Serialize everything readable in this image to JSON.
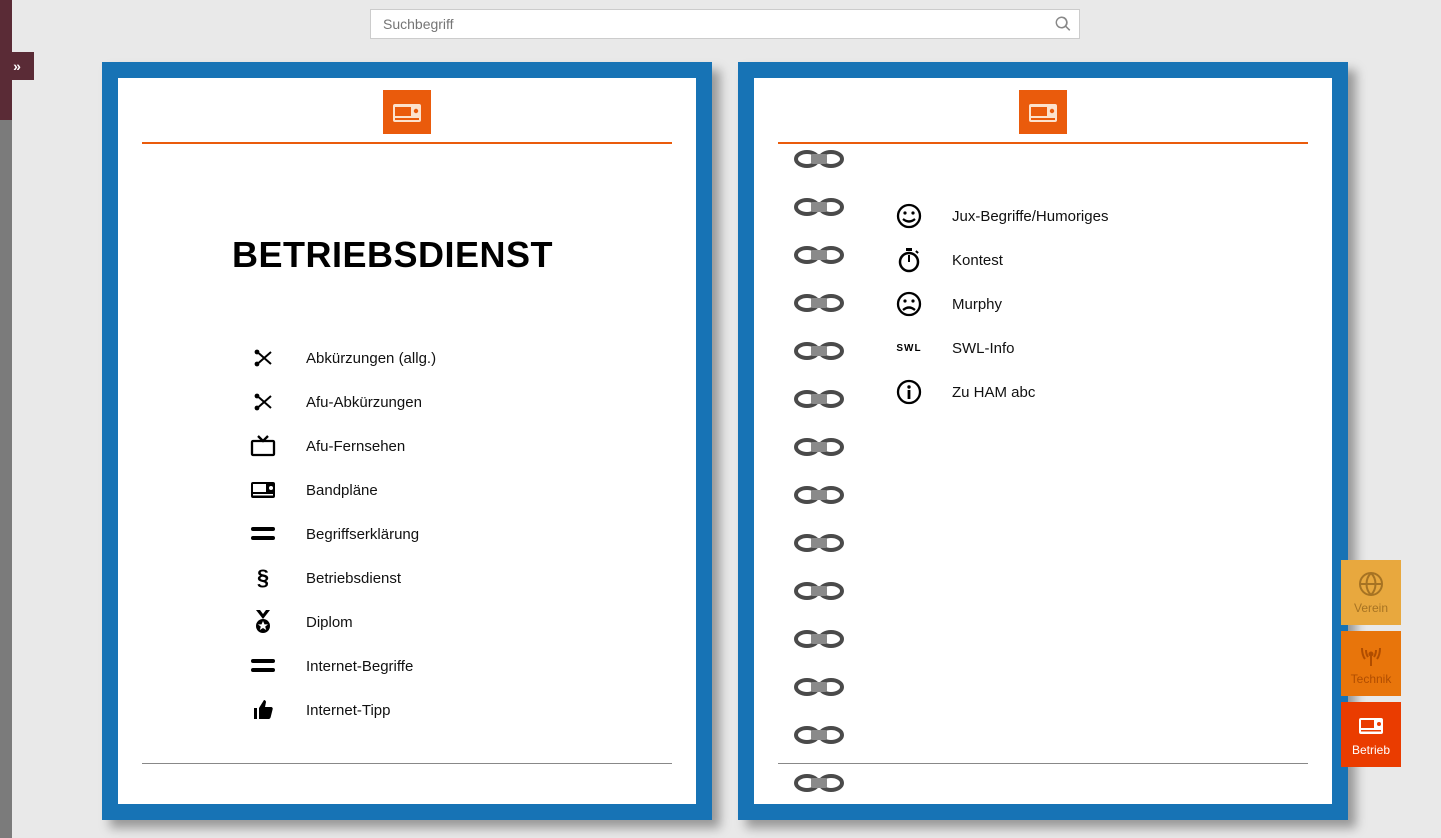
{
  "search": {
    "placeholder": "Suchbegriff"
  },
  "expand_label": "»",
  "page_title": "BETRIEBSDIENST",
  "left_items": [
    {
      "label": "Abkürzungen (allg.)"
    },
    {
      "label": "Afu-Abkürzungen"
    },
    {
      "label": "Afu-Fernsehen"
    },
    {
      "label": "Bandpläne"
    },
    {
      "label": "Begriffserklärung"
    },
    {
      "label": "Betriebsdienst"
    },
    {
      "label": "Diplom"
    },
    {
      "label": "Internet-Begriffe"
    },
    {
      "label": "Internet-Tipp"
    }
  ],
  "right_items": [
    {
      "label": "Jux-Begriffe/Humoriges"
    },
    {
      "label": "Kontest"
    },
    {
      "label": "Murphy"
    },
    {
      "label": "SWL-Info",
      "icon_text": "SWL"
    },
    {
      "label": "Zu HAM abc"
    }
  ],
  "tabs": [
    {
      "label": "Verein"
    },
    {
      "label": "Technik"
    },
    {
      "label": "Betrieb"
    }
  ]
}
